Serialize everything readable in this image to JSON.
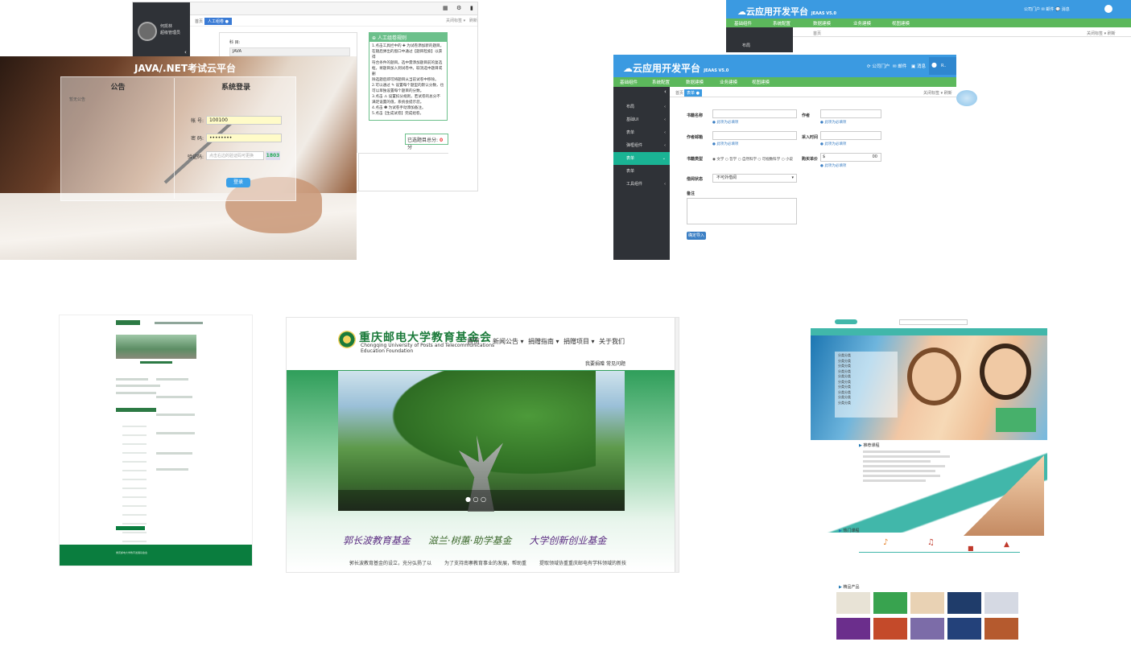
{
  "shot_exam_admin": {
    "user_line1": "何凯林",
    "user_line2": "超级管理员",
    "tabs": [
      "首页",
      "人工组卷"
    ],
    "subject_label": "科 目:",
    "subject_value": "JAVA",
    "tips_title": "人工组卷规则",
    "tips_lines": [
      "1.点击工具栏中的 ✚ 为试卷添加新的题目。",
      "在随后弹出的窗口中通过【题目检索】以获得",
      "符合条件的题目。选中需添加题目前的复选",
      "框，将题目加入到试卷中。取消选中题目或删",
      "除选题后即可将题目从当前试卷中移除。",
      "2.可以通过 ✎ 设置每个题型的默认分数，也",
      "可以单独设置每个题目的分数。",
      "3.点击 ⚠ 设置扣分规则，若试卷的总分不",
      "满足设置的值，系统会提示您。",
      "4.点击 ❶ 为试卷手动添加备注。",
      "5.点击【生成试卷】完成组卷。"
    ],
    "score_label": "已选题目总分:",
    "score_value": "0",
    "score_unit": "分"
  },
  "shot_login": {
    "title": "JAVA/.NET考试云平台",
    "notice_title": "公告",
    "notice_item": "暂无公告",
    "login_title": "系统登录",
    "account_label": "帐 号:",
    "account_value": "100100",
    "password_label": "密 码:",
    "password_value": "••••••••",
    "captcha_label": "验证码:",
    "captcha_placeholder": "点击右边的验证码可更换",
    "captcha_code": "1803",
    "login_button": "登录"
  },
  "shot_cloud_back": {
    "logo": "云应用开发平台",
    "version": "JEAAS V5.0",
    "header_right": "公司门户  ✉ 邮件  💬 消息",
    "nav": [
      "基础组件",
      "系统配置",
      "数据建模",
      "业务建模",
      "视图建模"
    ],
    "side_item": "布局",
    "tabs": [
      "首页"
    ],
    "right_tabs": "关闭标签 ▾   刷新"
  },
  "shot_cloud_form": {
    "logo": "云应用开发平台",
    "version": "JEAAS V5.0",
    "header_links": [
      "公司门户",
      "邮件",
      "消息"
    ],
    "user_name": "R..",
    "nav": [
      "基础组件",
      "系统配置",
      "数据建模",
      "业务建模",
      "视图建模"
    ],
    "side_items": [
      "布局",
      "基础UI",
      "表单",
      "弹框组件",
      "表单",
      "表单",
      "工具组件"
    ],
    "tabs": [
      "首页",
      "表单"
    ],
    "right_tabs": "关闭标签 ▾   刷新",
    "fields": {
      "book_name": "书籍名称",
      "author": "作者",
      "author_email": "作者邮箱",
      "buy_time": "采入时间",
      "book_type": "书籍类型",
      "price": "购买单价",
      "status": "借阅状态",
      "remark": "备注"
    },
    "required_note": "此项为必填项",
    "type_options": [
      "文学",
      "哲学",
      "自然科学",
      "可视数科学",
      "小说"
    ],
    "status_value": "不可外借阅",
    "price_prefix": "$",
    "price_suffix": "00",
    "submit_button": "确定导入"
  },
  "shot_green_site": {
    "footer_text": "重庆邮电大学教育发展基金会"
  },
  "shot_cqupt": {
    "cn_name": "重庆邮电大学教育基金会",
    "en_name_1": "Chongqing University of Posts and Telecommunications",
    "en_name_2": "Education Foundation",
    "menu": [
      "首页",
      "新闻公告 ▾",
      "捐赠指南 ▾",
      "捐赠项目 ▾",
      "关于我们"
    ],
    "sub_menu": [
      "我要捐赠",
      "常见问题"
    ],
    "slogans": [
      "郭长波教育基金",
      "滋兰·树蕙·助学基金",
      "大学创新创业基金"
    ],
    "col_texts": [
      "郭长波教育基金的设立，充分弘扬了以",
      "为了支持南寨教育事业的发展，帮助重",
      "提取领域协重重庆邮电有学科领域的新技"
    ]
  },
  "shot_kids": {
    "menu_items": [
      "分类分类",
      "分类分类",
      "分类分类",
      "分类分类",
      "分类分类",
      "分类分类",
      "分类分类",
      "分类分类",
      "分类分类",
      "分类分类"
    ],
    "news_title": "推荐课程",
    "hot_title": "热门课程",
    "products_title": "精品产品"
  },
  "colors": {
    "blue_header": "#3b9ae1",
    "green_nav": "#5cb85c",
    "dark_sidebar": "#2f3237",
    "teal": "#1ab394",
    "foundation_green": "#1b7a3a"
  }
}
